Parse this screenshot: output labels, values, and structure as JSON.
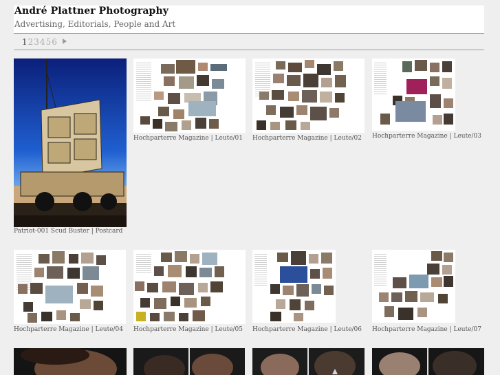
{
  "site": {
    "title": "André Plattner Photography",
    "subtitle": "Advertising, Editorials, People and Art"
  },
  "pagination": {
    "pages": [
      "1",
      "2",
      "3",
      "4",
      "5",
      "6"
    ],
    "current": "1"
  },
  "gallery": {
    "row1": [
      {
        "caption": "Patriot-001 Scud Buster | Postcard",
        "kind": "photo"
      },
      {
        "caption": "Hochparterre Magazine | Leute/01",
        "kind": "magazine"
      },
      {
        "caption": "Hochparterre Magazine | Leute/02",
        "kind": "magazine"
      },
      {
        "caption": "Hochparterre Magazine | Leute/03",
        "kind": "magazine"
      }
    ],
    "row2": [
      {
        "caption": "Hochparterre Magazine | Leute/04",
        "kind": "magazine"
      },
      {
        "caption": "Hochparterre Magazine | Leute/05",
        "kind": "magazine"
      },
      {
        "caption": "Hochparterre Magazine | Leute/06",
        "kind": "magazine"
      },
      {
        "caption": "Hochparterre Magazine | Leute/07",
        "kind": "magazine"
      }
    ]
  }
}
